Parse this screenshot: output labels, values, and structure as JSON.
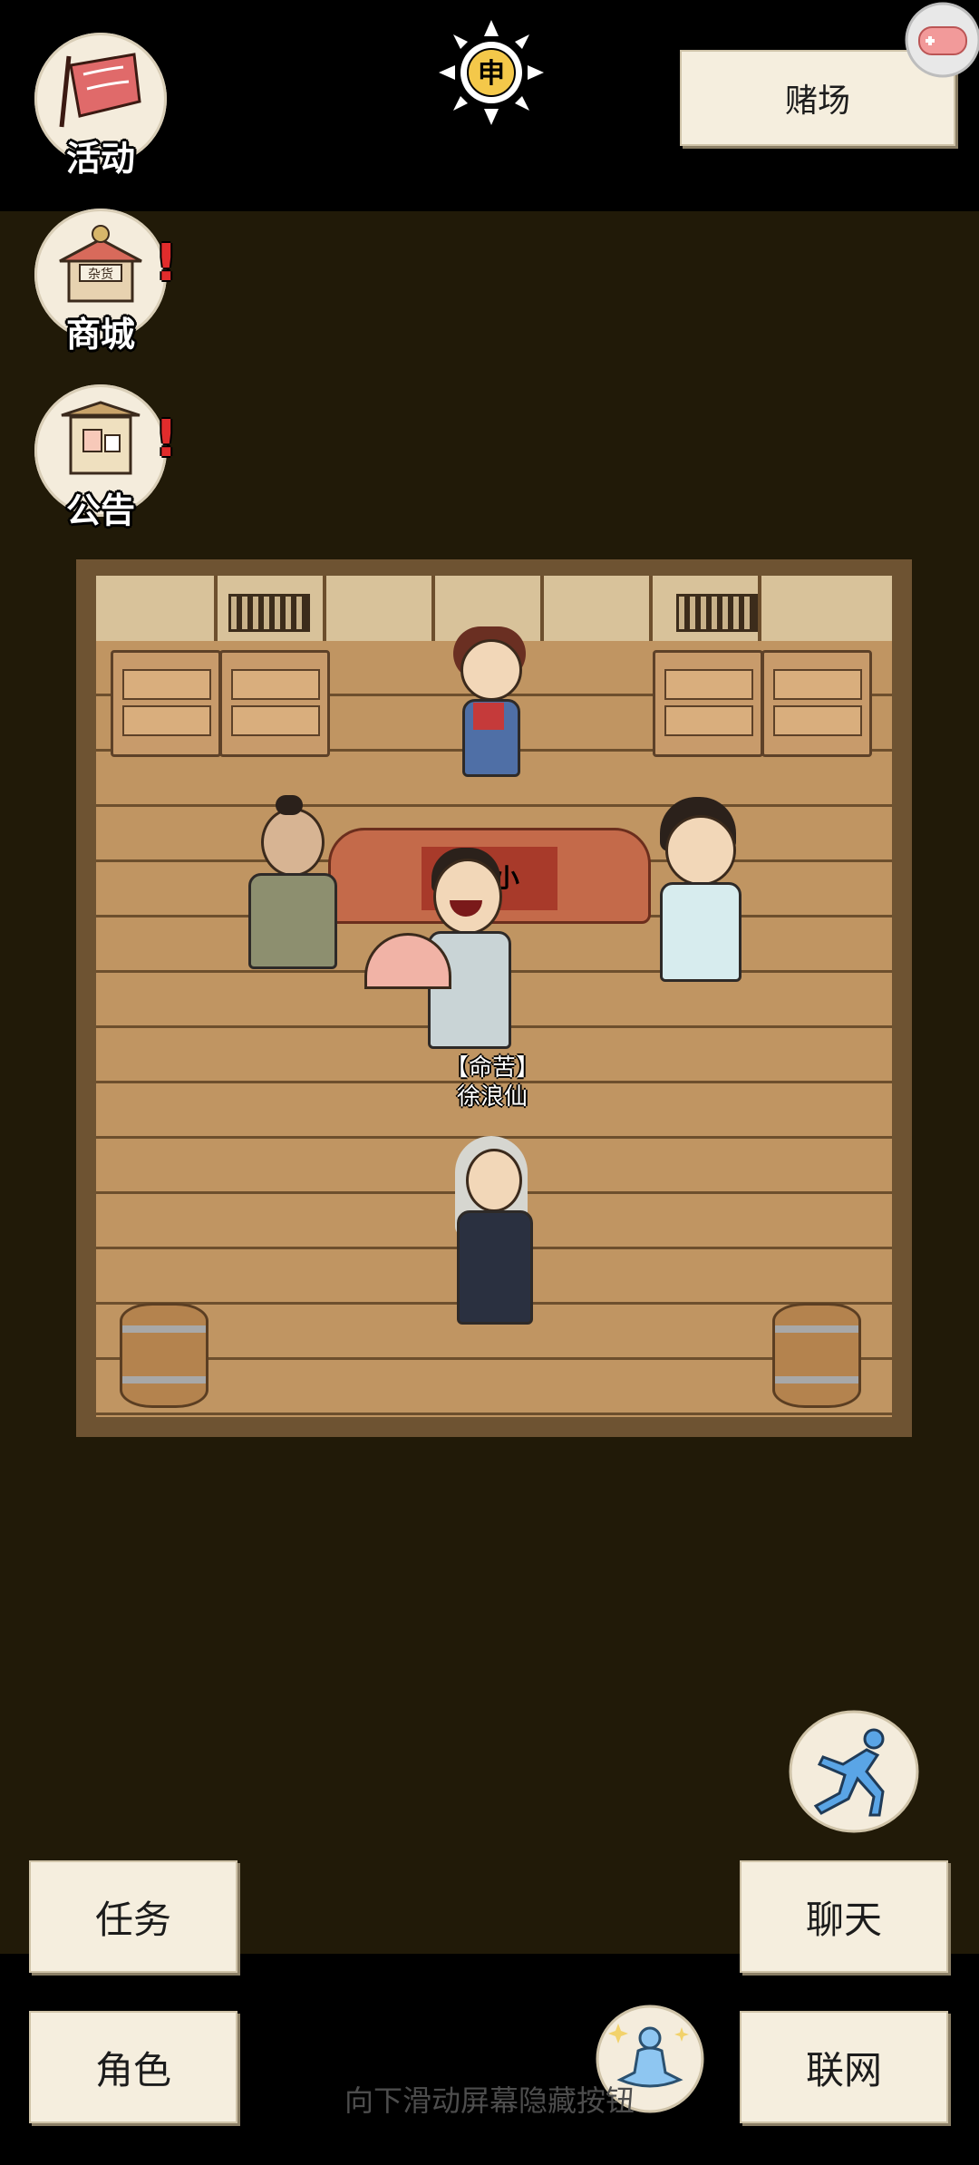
{
  "location": "赌场",
  "time_glyph": "申",
  "menu": {
    "activity": "活动",
    "shop": "商城",
    "notice": "公告"
  },
  "npc": {
    "title": "【命苦】",
    "name": "徐浪仙"
  },
  "table_sign": "大  小",
  "buttons": {
    "task": "任务",
    "role": "角色",
    "chat": "聊天",
    "network": "联网"
  },
  "hint": "向下滑动屏幕隐藏按钮",
  "shop_sign": "杂货",
  "colors": {
    "background": "#211a08",
    "paper": "#f5eede",
    "alert": "#e12c2c"
  }
}
